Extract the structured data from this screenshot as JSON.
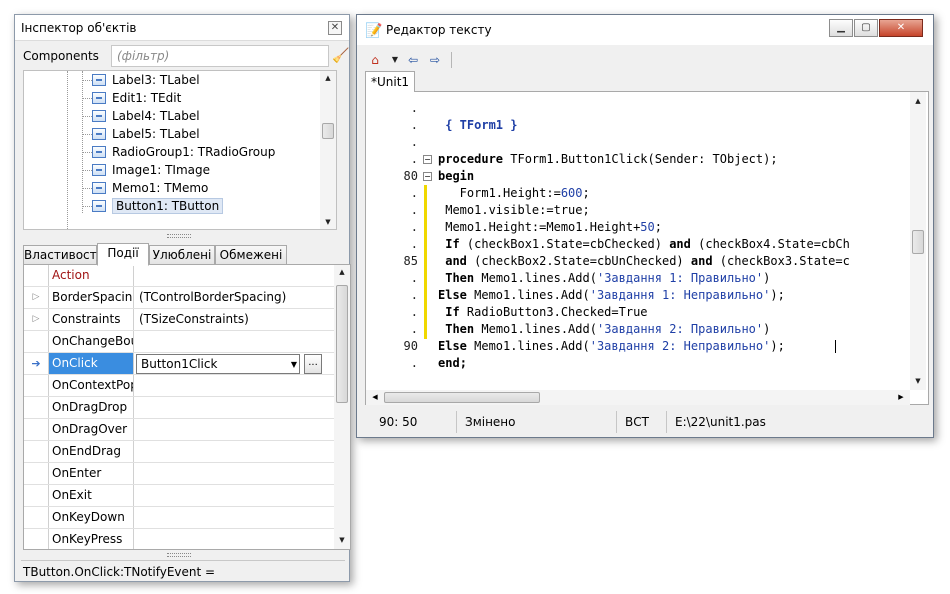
{
  "inspector": {
    "title": "Інспектор об'єктів",
    "components_label": "Components",
    "filter_placeholder": "(фільтр)",
    "tree_items": [
      "Label3: TLabel",
      "Edit1: TEdit",
      "Label4: TLabel",
      "Label5: TLabel",
      "RadioGroup1: TRadioGroup",
      "Image1: TImage",
      "Memo1: TMemo",
      "Button1: TButton"
    ],
    "tabs": [
      "Властивості",
      "Події",
      "Улюблені",
      "Обмежені"
    ],
    "active_tab": "Події",
    "grid_rows": [
      {
        "name": "Action",
        "value": ""
      },
      {
        "name": "BorderSpacing",
        "value": "(TControlBorderSpacing)"
      },
      {
        "name": "Constraints",
        "value": "(TSizeConstraints)"
      },
      {
        "name": "OnChangeBoun",
        "value": ""
      },
      {
        "name": "OnClick",
        "value": "Button1Click"
      },
      {
        "name": "OnContextPopu",
        "value": ""
      },
      {
        "name": "OnDragDrop",
        "value": ""
      },
      {
        "name": "OnDragOver",
        "value": ""
      },
      {
        "name": "OnEndDrag",
        "value": ""
      },
      {
        "name": "OnEnter",
        "value": ""
      },
      {
        "name": "OnExit",
        "value": ""
      },
      {
        "name": "OnKeyDown",
        "value": ""
      },
      {
        "name": "OnKeyPress",
        "value": ""
      }
    ],
    "status_text": "TButton.OnClick:TNotifyEvent ="
  },
  "editor": {
    "title": "Редактор тексту",
    "tab_label": "*Unit1",
    "gutter": [
      ".",
      ".",
      ".",
      ".",
      "80",
      ".",
      ".",
      ".",
      ".",
      "85",
      ".",
      ".",
      ".",
      ".",
      "90",
      "."
    ],
    "code_lines": [
      "",
      " { TForm1 }",
      "",
      "procedure TForm1.Button1Click(Sender: TObject);",
      "begin",
      "   Form1.Height:=600;",
      " Memo1.visible:=true;",
      " Memo1.Height:=Memo1.Height+50;",
      " If (checkBox1.State=cbChecked) and (checkBox4.State=cbCh",
      " and (checkBox2.State=cbUnChecked) and (checkBox3.State=c",
      " Then Memo1.lines.Add('Завдання 1: Правильно')",
      "Else Memo1.lines.Add('Завдання 1: Неправильно');",
      " If RadioButton3.Checked=True",
      " Then Memo1.lines.Add('Завдання 2: Правильно')",
      "Else Memo1.lines.Add('Завдання 2: Неправильно');",
      "end;"
    ],
    "status": {
      "position": "90: 50",
      "modified": "Змінено",
      "mode": "ВСТ",
      "file": "E:\\22\\unit1.pas"
    }
  },
  "colors": {
    "selection": "#3a8de0",
    "string": "#1f3fa6",
    "modified_bar": "#f0d800"
  }
}
